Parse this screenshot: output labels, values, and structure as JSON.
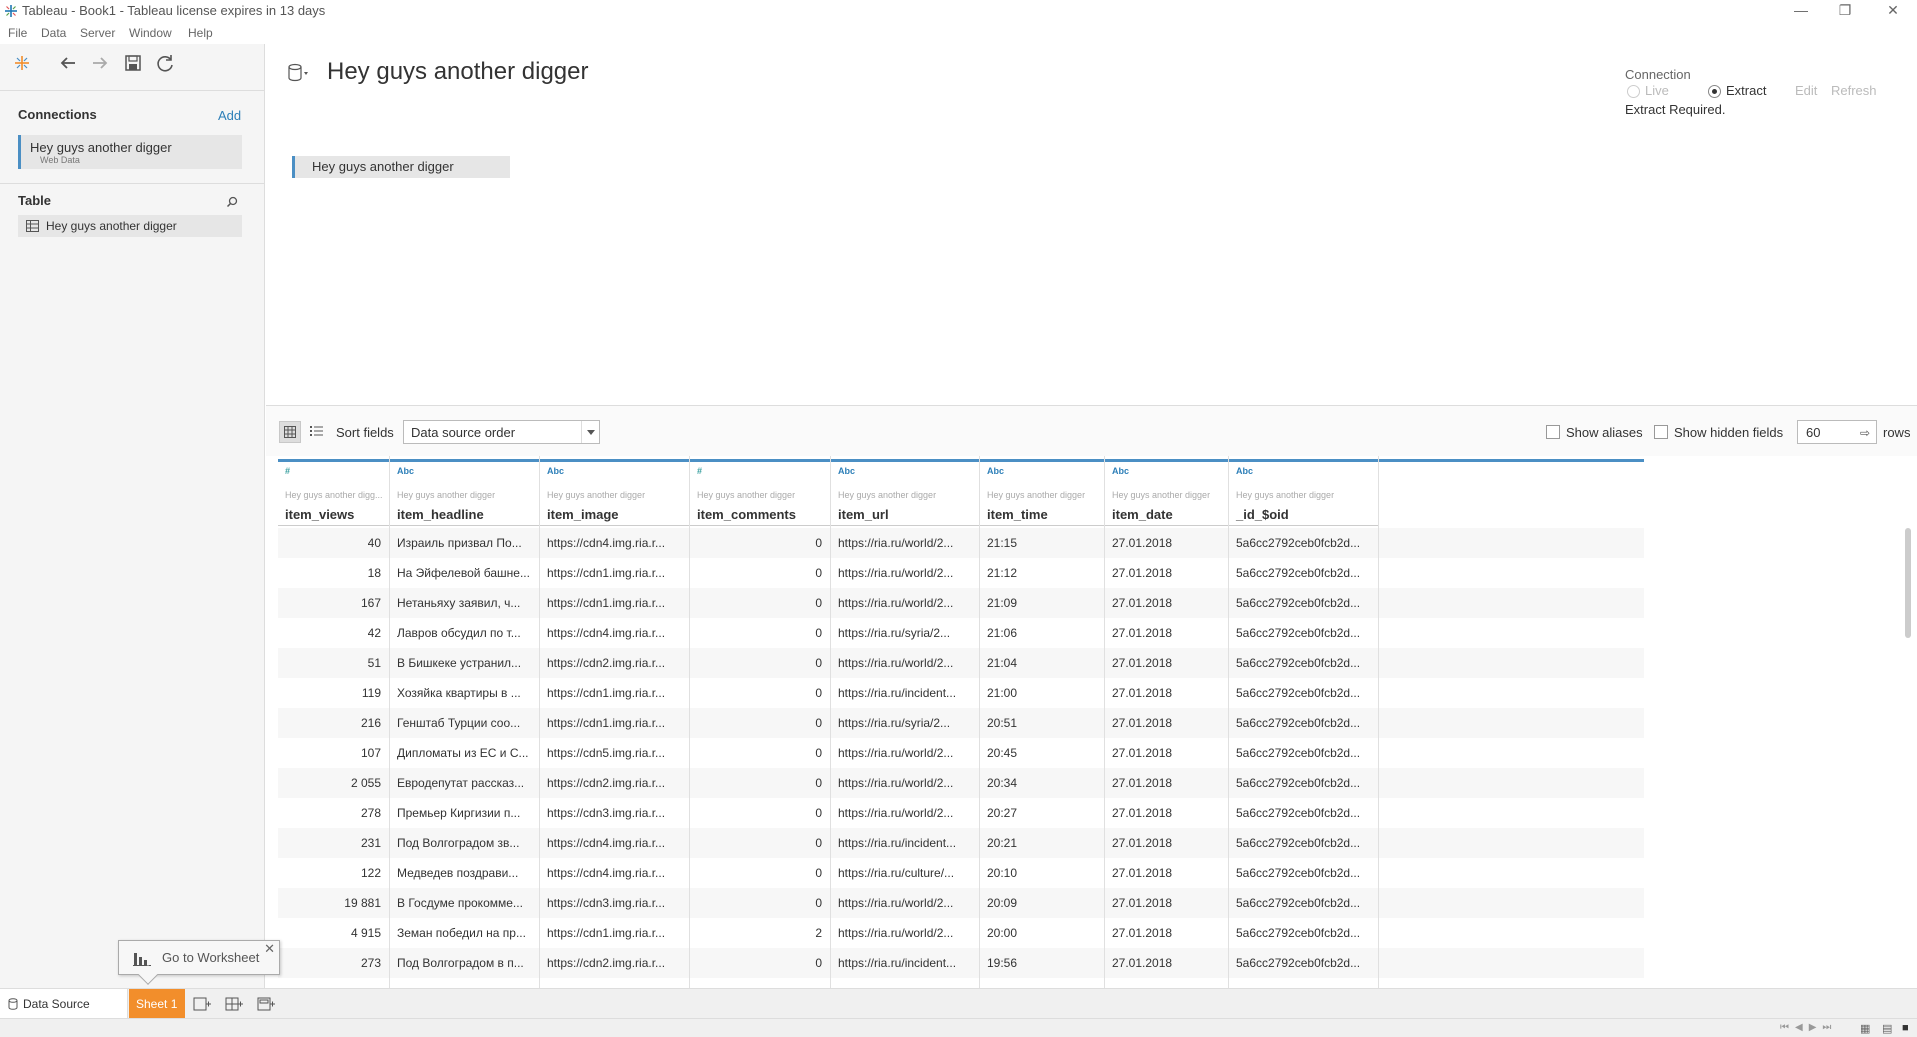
{
  "window": {
    "title": "Tableau - Book1 - Tableau license expires in 13 days"
  },
  "menu": [
    "File",
    "Data",
    "Server",
    "Window",
    "Help"
  ],
  "connections": {
    "heading": "Connections",
    "add_label": "Add",
    "items": [
      {
        "name": "Hey guys another digger",
        "type": "Web Data"
      }
    ]
  },
  "table_section": {
    "heading": "Table",
    "items": [
      {
        "name": "Hey guys another digger"
      }
    ]
  },
  "canvas": {
    "datasource_title": "Hey guys another digger",
    "table_label": "Hey guys another digger"
  },
  "connection_panel": {
    "label": "Connection",
    "live": "Live",
    "extract": "Extract",
    "selected": "Extract",
    "edit": "Edit",
    "refresh": "Refresh",
    "status": "Extract Required."
  },
  "grid_toolbar": {
    "sort_label": "Sort fields",
    "sort_value": "Data source order",
    "show_aliases": "Show aliases",
    "show_hidden": "Show hidden fields",
    "rows_value": "60",
    "rows_label": "rows"
  },
  "grid": {
    "columns": [
      {
        "type": "#",
        "source": "Hey guys another digg...",
        "name": "item_views",
        "align": "right"
      },
      {
        "type": "Abc",
        "source": "Hey guys another digger",
        "name": "item_headline",
        "align": "left"
      },
      {
        "type": "Abc",
        "source": "Hey guys another digger",
        "name": "item_image",
        "align": "left"
      },
      {
        "type": "#",
        "source": "Hey guys another digger",
        "name": "item_comments",
        "align": "right"
      },
      {
        "type": "Abc",
        "source": "Hey guys another digger",
        "name": "item_url",
        "align": "left"
      },
      {
        "type": "Abc",
        "source": "Hey guys another digger",
        "name": "item_time",
        "align": "left"
      },
      {
        "type": "Abc",
        "source": "Hey guys another digger",
        "name": "item_date",
        "align": "left"
      },
      {
        "type": "Abc",
        "source": "Hey guys another digger",
        "name": "_id_$oid",
        "align": "left"
      }
    ],
    "rows": [
      [
        "40",
        "Израиль призвал По...",
        "https://cdn4.img.ria.r...",
        "0",
        "https://ria.ru/world/2...",
        "21:15",
        "27.01.2018",
        "5a6cc2792ceb0fcb2d..."
      ],
      [
        "18",
        "На Эйфелевой башне...",
        "https://cdn1.img.ria.r...",
        "0",
        "https://ria.ru/world/2...",
        "21:12",
        "27.01.2018",
        "5a6cc2792ceb0fcb2d..."
      ],
      [
        "167",
        "Нетаньяху заявил, ч...",
        "https://cdn1.img.ria.r...",
        "0",
        "https://ria.ru/world/2...",
        "21:09",
        "27.01.2018",
        "5a6cc2792ceb0fcb2d..."
      ],
      [
        "42",
        "Лавров обсудил по т...",
        "https://cdn4.img.ria.r...",
        "0",
        "https://ria.ru/syria/2...",
        "21:06",
        "27.01.2018",
        "5a6cc2792ceb0fcb2d..."
      ],
      [
        "51",
        "В Бишкеке устранил...",
        "https://cdn2.img.ria.r...",
        "0",
        "https://ria.ru/world/2...",
        "21:04",
        "27.01.2018",
        "5a6cc2792ceb0fcb2d..."
      ],
      [
        "119",
        "Хозяйка квартиры в ...",
        "https://cdn1.img.ria.r...",
        "0",
        "https://ria.ru/incident...",
        "21:00",
        "27.01.2018",
        "5a6cc2792ceb0fcb2d..."
      ],
      [
        "216",
        "Генштаб Турции соо...",
        "https://cdn1.img.ria.r...",
        "0",
        "https://ria.ru/syria/2...",
        "20:51",
        "27.01.2018",
        "5a6cc2792ceb0fcb2d..."
      ],
      [
        "107",
        "Дипломаты из ЕС и С...",
        "https://cdn5.img.ria.r...",
        "0",
        "https://ria.ru/world/2...",
        "20:45",
        "27.01.2018",
        "5a6cc2792ceb0fcb2d..."
      ],
      [
        "2 055",
        "Евродепутат рассказ...",
        "https://cdn2.img.ria.r...",
        "0",
        "https://ria.ru/world/2...",
        "20:34",
        "27.01.2018",
        "5a6cc2792ceb0fcb2d..."
      ],
      [
        "278",
        "Премьер Киргизии п...",
        "https://cdn3.img.ria.r...",
        "0",
        "https://ria.ru/world/2...",
        "20:27",
        "27.01.2018",
        "5a6cc2792ceb0fcb2d..."
      ],
      [
        "231",
        "Под Волгоградом зв...",
        "https://cdn4.img.ria.r...",
        "0",
        "https://ria.ru/incident...",
        "20:21",
        "27.01.2018",
        "5a6cc2792ceb0fcb2d..."
      ],
      [
        "122",
        "Медведев поздрави...",
        "https://cdn4.img.ria.r...",
        "0",
        "https://ria.ru/culture/...",
        "20:10",
        "27.01.2018",
        "5a6cc2792ceb0fcb2d..."
      ],
      [
        "19 881",
        "В Госдуме прокомме...",
        "https://cdn3.img.ria.r...",
        "0",
        "https://ria.ru/world/2...",
        "20:09",
        "27.01.2018",
        "5a6cc2792ceb0fcb2d..."
      ],
      [
        "4 915",
        "Земан победил на пр...",
        "https://cdn1.img.ria.r...",
        "2",
        "https://ria.ru/world/2...",
        "20:00",
        "27.01.2018",
        "5a6cc2792ceb0fcb2d..."
      ],
      [
        "273",
        "Под Волгоградом в п...",
        "https://cdn2.img.ria.r...",
        "0",
        "https://ria.ru/incident...",
        "19:56",
        "27.01.2018",
        "5a6cc2792ceb0fcb2d..."
      ]
    ]
  },
  "tabs": {
    "data_source": "Data Source",
    "sheet": "Sheet 1"
  },
  "tooltip": {
    "label": "Go to Worksheet"
  },
  "colors": {
    "accent": "#4b8fc4",
    "sheet_tab": "#f28e2b",
    "link": "#2d7fb8"
  }
}
